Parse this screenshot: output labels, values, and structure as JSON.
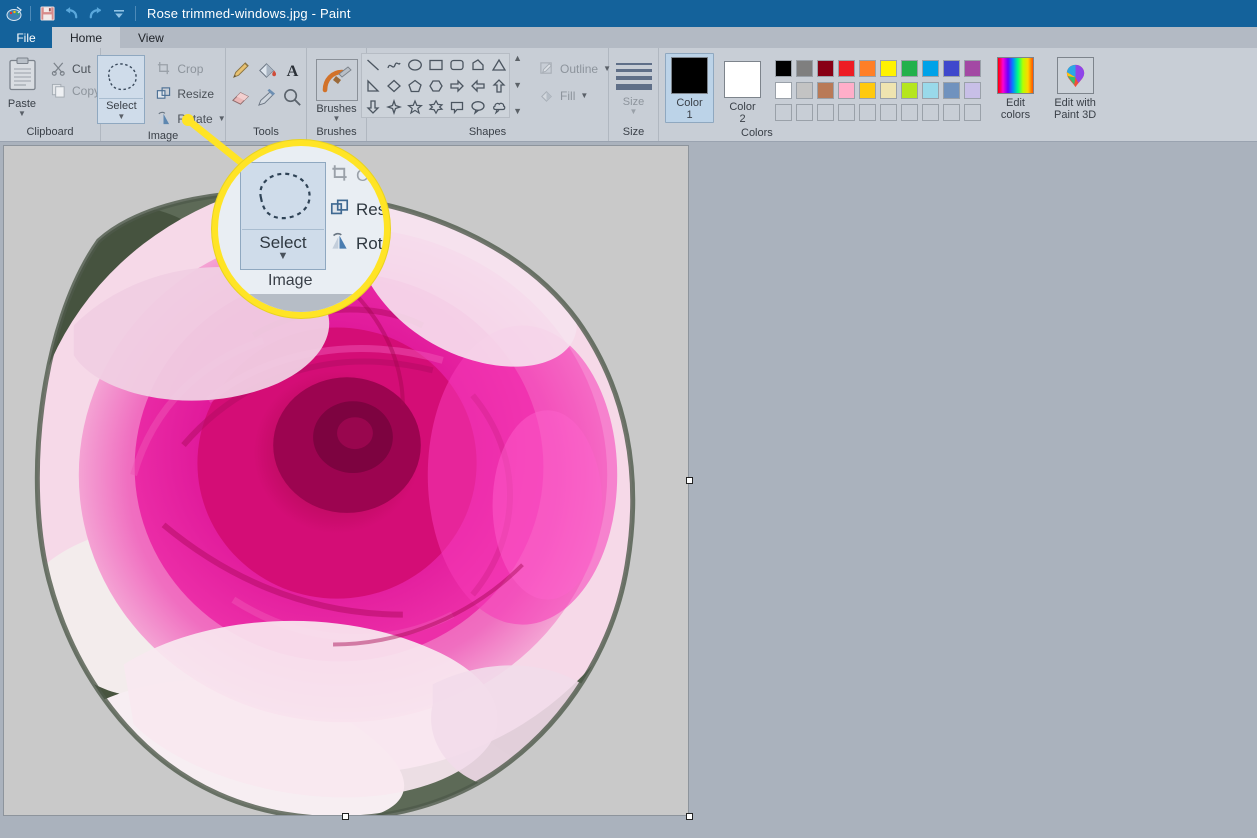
{
  "window": {
    "title": "Rose trimmed-windows.jpg - Paint",
    "app_name": "Paint",
    "file_name": "Rose trimmed-windows.jpg",
    "titlebar_color": "#14629b"
  },
  "quick_access": [
    {
      "name": "paint-app-icon",
      "label": "Paint"
    },
    {
      "name": "save-icon",
      "label": "Save"
    },
    {
      "name": "undo-icon",
      "label": "Undo"
    },
    {
      "name": "redo-icon",
      "label": "Redo"
    },
    {
      "name": "customize-quick-access-icon",
      "label": "Customize Quick Access Toolbar"
    }
  ],
  "menu": {
    "file_label": "File",
    "tabs": [
      {
        "label": "Home",
        "active": true
      },
      {
        "label": "View",
        "active": false
      }
    ]
  },
  "ribbon": {
    "groups": [
      {
        "label": "Clipboard",
        "big_button": {
          "label": "Paste",
          "icon": "clipboard-icon",
          "has_caret": true
        },
        "items": [
          {
            "label": "Cut",
            "icon": "scissors-icon",
            "disabled": false
          },
          {
            "label": "Copy",
            "icon": "copy-icon",
            "disabled": true
          }
        ]
      },
      {
        "label": "Image",
        "select_label": "Select",
        "select_icon": "freeform-selection-icon",
        "items": [
          {
            "label": "Crop",
            "icon": "crop-icon",
            "disabled": true
          },
          {
            "label": "Resize",
            "icon": "resize-icon",
            "disabled": false
          },
          {
            "label": "Rotate",
            "icon": "rotate-icon",
            "disabled": false,
            "has_caret": true
          }
        ]
      },
      {
        "label": "Tools",
        "tools": [
          {
            "name": "pencil-icon",
            "label": "Pencil"
          },
          {
            "name": "fill-with-color-icon",
            "label": "Fill with color"
          },
          {
            "name": "text-icon",
            "label": "Text"
          },
          {
            "name": "eraser-icon",
            "label": "Eraser"
          },
          {
            "name": "color-picker-icon",
            "label": "Color picker"
          },
          {
            "name": "magnifier-icon",
            "label": "Magnifier"
          }
        ]
      },
      {
        "label": "Brushes",
        "big_button": {
          "label": "Brushes",
          "icon": "brush-icon",
          "has_caret": true
        }
      },
      {
        "label": "Shapes",
        "shapes": [
          "line-shape",
          "curve-shape",
          "oval-shape",
          "rectangle-shape",
          "rounded-rectangle-shape",
          "polygon-shape",
          "triangle-shape",
          "right-triangle-shape",
          "diamond-shape",
          "pentagon-shape",
          "hexagon-shape",
          "right-arrow-shape",
          "left-arrow-shape",
          "up-arrow-shape",
          "down-arrow-shape",
          "four-point-star-shape",
          "five-point-star-shape",
          "six-point-star-shape",
          "rounded-callout-shape",
          "oval-callout-shape",
          "cloud-callout-shape"
        ],
        "scroll": [
          "scroll-up-icon",
          "scroll-down-icon",
          "more-shapes-icon"
        ],
        "items": [
          {
            "label": "Outline",
            "icon": "outline-icon",
            "has_caret": true,
            "disabled": true
          },
          {
            "label": "Fill",
            "icon": "fill-icon",
            "has_caret": true,
            "disabled": true
          }
        ]
      },
      {
        "label": "Size",
        "big_button": {
          "label": "Size",
          "icon": "size-icon",
          "has_caret": true,
          "disabled": true
        }
      },
      {
        "label": "Colors",
        "color1": {
          "label_line1": "Color",
          "label_line2": "1",
          "value": "#000000",
          "selected": true
        },
        "color2": {
          "label_line1": "Color",
          "label_line2": "2",
          "value": "#ffffff",
          "selected": false
        },
        "palette_row1": [
          "#000000",
          "#7f7f7f",
          "#880015",
          "#ed1c24",
          "#ff7f27",
          "#fff200",
          "#22b14c",
          "#00a2e8",
          "#3f48cc",
          "#a349a4"
        ],
        "palette_row2": [
          "#ffffff",
          "#c3c3c3",
          "#b97a57",
          "#ffaec9",
          "#ffc90e",
          "#efe4b0",
          "#b5e61d",
          "#99d9ea",
          "#7092be",
          "#c8bfe7"
        ],
        "palette_row3": [
          "",
          "",
          "",
          "",
          "",
          "",
          "",
          "",
          "",
          ""
        ],
        "edit_colors": {
          "label_line1": "Edit",
          "label_line2": "colors",
          "icon": "rainbow-palette-icon"
        },
        "paint3d": {
          "label_line1": "Edit with",
          "label_line2": "Paint 3D",
          "icon": "paint3d-icon"
        }
      }
    ]
  },
  "canvas": {
    "image_alt": "Magenta pink rose photograph with background trimmed away",
    "handles": [
      "right-middle-handle",
      "bottom-left-handle",
      "bottom-right-handle",
      "bottom-middle-handle"
    ]
  },
  "callout": {
    "border_color": "#ffe425",
    "select_label": "Select",
    "group_label": "Image",
    "items": [
      {
        "label": "Crop",
        "icon": "crop-icon",
        "disabled": true
      },
      {
        "label": "Resize",
        "icon": "resize-icon",
        "disabled": false
      },
      {
        "label": "Rotate",
        "icon": "rotate-icon",
        "disabled": false
      }
    ]
  }
}
